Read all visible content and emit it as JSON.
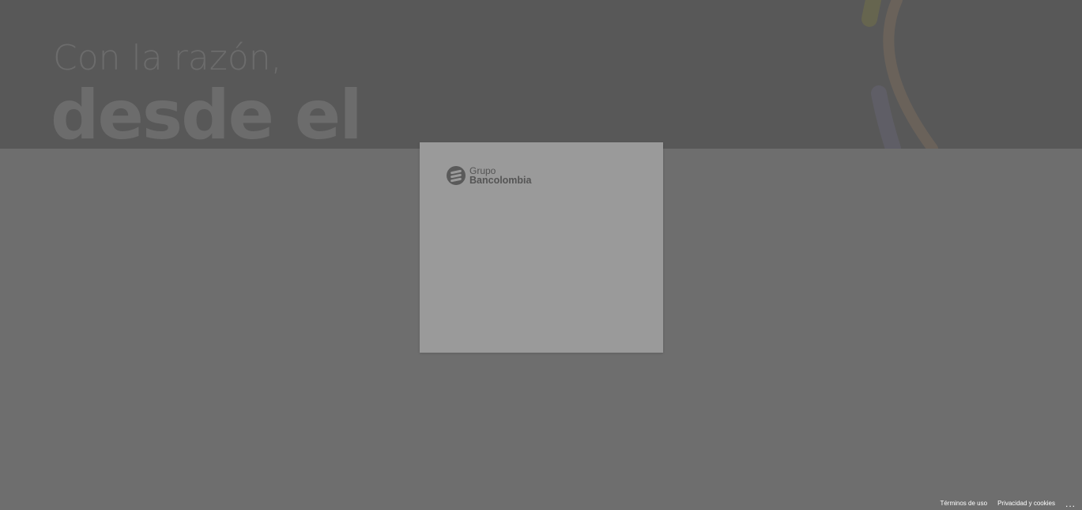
{
  "hero": {
    "line1": "Con la razón,",
    "line2": "desde el"
  },
  "logo": {
    "line1": "Grupo",
    "line2": "Bancolombia",
    "icon": "bancolombia-logo-icon"
  },
  "footer": {
    "terms": "Términos de uso",
    "privacy": "Privacidad y cookies",
    "more": "..."
  },
  "colors": {
    "overlay_dark": "#585858",
    "overlay_light": "#6e6e6e",
    "card": "#9a9a9a"
  }
}
